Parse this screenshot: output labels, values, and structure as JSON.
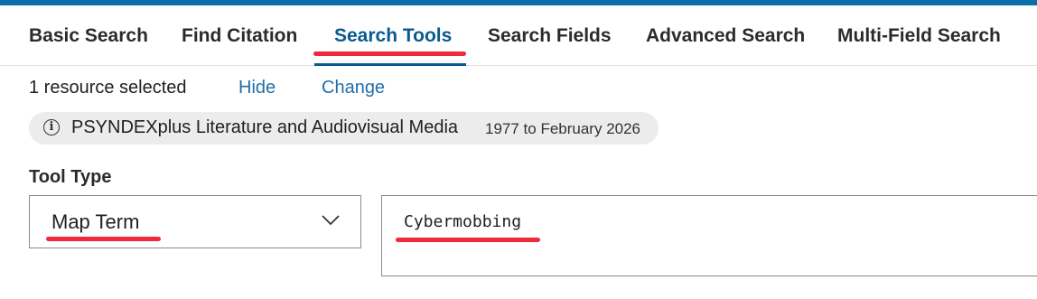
{
  "tabs": [
    {
      "label": "Basic Search"
    },
    {
      "label": "Find Citation"
    },
    {
      "label": "Search Tools"
    },
    {
      "label": "Search Fields"
    },
    {
      "label": "Advanced Search"
    },
    {
      "label": "Multi-Field Search"
    }
  ],
  "active_tab": "Search Tools",
  "resources": {
    "selected_text": "1 resource selected",
    "hide_label": "Hide",
    "change_label": "Change",
    "database": {
      "icon": "info-icon",
      "name": "PSYNDEXplus Literature and Audiovisual Media",
      "range": "1977 to February 2026"
    }
  },
  "tool": {
    "label": "Tool Type",
    "selected": "Map Term"
  },
  "term": {
    "value": "Cybermobbing"
  },
  "colors": {
    "accent": "#0a6ea8",
    "active_tab": "#0a5a8e",
    "link": "#1f6fa8",
    "annotation": "#f0293e",
    "pill_bg": "#ececec"
  }
}
